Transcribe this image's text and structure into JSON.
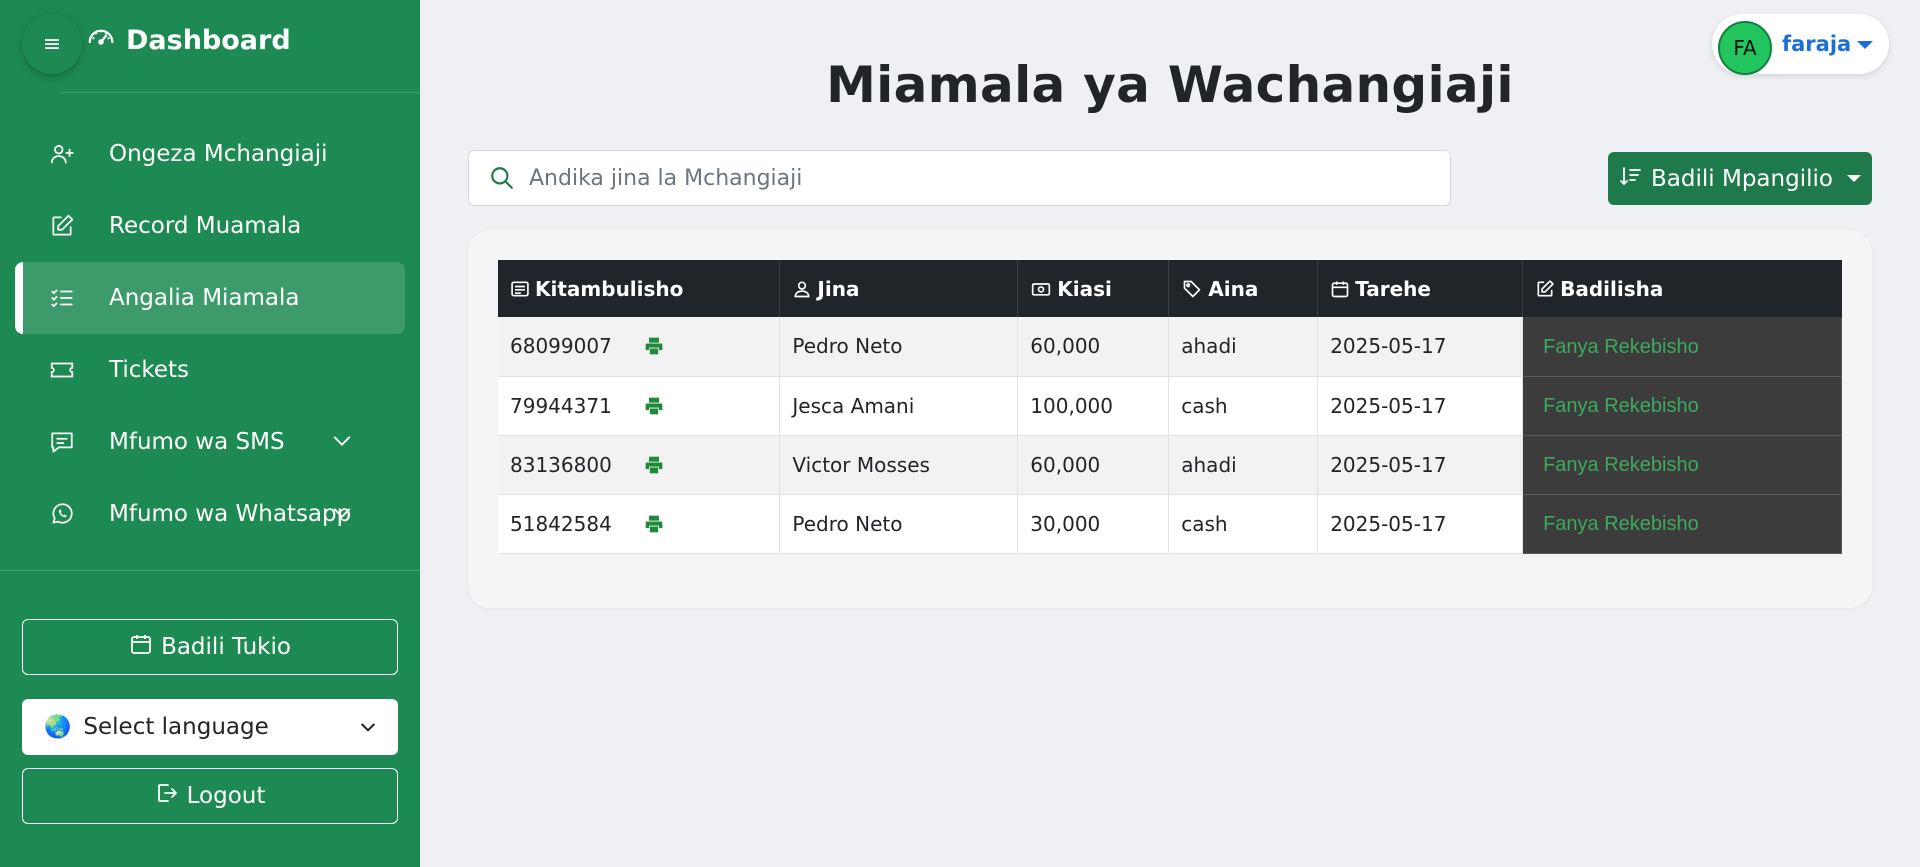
{
  "sidebar": {
    "brand": "Dashboard",
    "menu_icon": "hamburger-icon",
    "items": [
      {
        "label": "Ongeza Mchangiaji",
        "icon": "user-plus-icon"
      },
      {
        "label": "Record Muamala",
        "icon": "edit-icon"
      },
      {
        "label": "Angalia Miamala",
        "icon": "list-check-icon",
        "active": true
      },
      {
        "label": "Tickets",
        "icon": "ticket-icon"
      },
      {
        "label": "Mfumo wa SMS",
        "icon": "chat-icon",
        "expandable": true
      },
      {
        "label": "Mfumo wa Whatsapp",
        "icon": "whatsapp-icon",
        "expandable": true
      }
    ],
    "change_event_label": "Badili Tukio",
    "language_label": "Select language",
    "logout_label": "Logout"
  },
  "header": {
    "title": "Miamala ya Wachangiaji",
    "user_initials": "FA",
    "username": "faraja"
  },
  "search": {
    "placeholder": "Andika jina la Mchangiaji"
  },
  "sort": {
    "label": "Badili Mpangilio"
  },
  "table": {
    "columns": [
      "Kitambulisho",
      "Jina",
      "Kiasi",
      "Aina",
      "Tarehe",
      "Badilisha"
    ],
    "rows": [
      {
        "id": "68099007",
        "name": "Pedro Neto",
        "amount": "60,000",
        "type": "ahadi",
        "date": "2025-05-17",
        "action": "Fanya Rekebisho"
      },
      {
        "id": "79944371",
        "name": "Jesca Amani",
        "amount": "100,000",
        "type": "cash",
        "date": "2025-05-17",
        "action": "Fanya Rekebisho"
      },
      {
        "id": "83136800",
        "name": "Victor Mosses",
        "amount": "60,000",
        "type": "ahadi",
        "date": "2025-05-17",
        "action": "Fanya Rekebisho"
      },
      {
        "id": "51842584",
        "name": "Pedro Neto",
        "amount": "30,000",
        "type": "cash",
        "date": "2025-05-17",
        "action": "Fanya Rekebisho"
      }
    ]
  },
  "colors": {
    "sidebar_bg": "#1e8a53",
    "primary_green": "#1e7a4b",
    "link_green": "#3ea85d",
    "user_blue": "#1d6fd8"
  }
}
